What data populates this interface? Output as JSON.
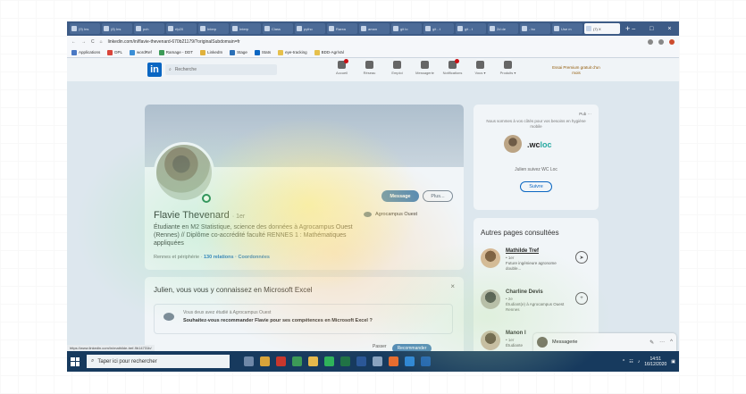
{
  "browser": {
    "tabs": [
      "(9) Ins",
      "(8) Ins",
      "pch",
      "rfp20",
      "Interp",
      "Interp",
      "Class",
      "pytho",
      "Rarea",
      "aman",
      "git lo",
      "git - t",
      "git - t",
      "2d de",
      "- bu",
      "Use m",
      "(7) X"
    ],
    "new_tab": "+",
    "window_controls": [
      "–",
      "□",
      "×"
    ],
    "nav_buttons": [
      "←",
      "→",
      "C",
      "⌂"
    ],
    "url": "linkedin.com/in/flavie-thevenard-670b21179/?originalSubdomain=fr",
    "bookmarks": [
      "Applications",
      "DPL",
      "wordRef",
      "Ramage - DDT",
      "LinkedIn",
      "Stage",
      "Stats",
      "eye-tracking",
      "BDD-AgriVal"
    ]
  },
  "linkedin": {
    "logo": "in",
    "search_placeholder": "Recherche",
    "nav": [
      "Accueil",
      "Réseau",
      "Emploi",
      "Messagerie",
      "Notifications",
      "Vous ▾",
      "Produits ▾"
    ],
    "premium": "Essai Premium gratuit d'un mois"
  },
  "profile": {
    "name": "Flavie Thevenard",
    "degree": "· 1er",
    "headline": "Étudiante en M2 Statistique, science des données à Agrocampus Ouest (Rennes) // Diplôme co-accrédité faculté RENNES 1 : Mathématiques appliquées",
    "location": "Rennes et périphérie ·",
    "relations": "130 relations",
    "coordinates": "· Coordonnées",
    "school": "Agrocampus Ouest",
    "message_btn": "Message",
    "more_btn": "Plus..."
  },
  "excel": {
    "title": "Julien, vous vous y connaissez en Microsoft Excel",
    "close": "×",
    "small": "Vous deux avez étudié à Agrocampus Ouest",
    "question": "Souhaitez-vous recommander Flavie pour ses compétences en Microsoft Excel ?",
    "btn_no": "Passer",
    "btn_yes": "Recommander"
  },
  "promo": {
    "pub": "Pub ···",
    "text": "Nous sommes à vos côtés pour vos besoins en hygiène mobile",
    "logo_pre": ".wc",
    "logo_post": "loc",
    "follow": "Julien suivez WC Loc",
    "button": "Suivre"
  },
  "pages": {
    "title": "Autres pages consultées",
    "people": [
      {
        "name": "Mathilde Tref",
        "degree": "• 1er",
        "desc": "Future ingénieure agronome double...",
        "btn": "➤"
      },
      {
        "name": "Charline Devis",
        "degree": "• 2e",
        "desc": "Étudiant(e) à Agrocampus Ouest Rennes",
        "btn": "+"
      },
      {
        "name": "Manon I",
        "degree": "• 1er",
        "desc": "Étudiante",
        "btn": "➤"
      }
    ]
  },
  "messaging": {
    "label": "Messagerie",
    "controls": [
      "✎",
      "···",
      "^"
    ]
  },
  "statusbar": "https://www.linkedin.com/in/mathilde-tref-9b14731b/",
  "taskbar": {
    "search": "Taper ici pour rechercher",
    "time": "14:51",
    "date": "16/12/2020"
  },
  "colors": {
    "linkedin_blue": "#0a66c2",
    "taskbar": "#173a5e",
    "tabbar": "#3d5b86"
  }
}
